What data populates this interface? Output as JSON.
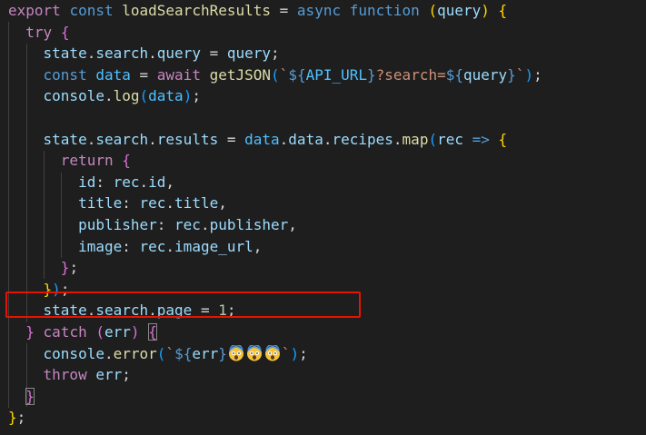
{
  "editor": {
    "background": "#1e1e1e",
    "highlight_color": "#e51400",
    "emoji_name": "face-screaming-in-fear",
    "lines": [
      [
        {
          "t": "export",
          "c": "kw2"
        },
        {
          "t": " "
        },
        {
          "t": "const",
          "c": "kw"
        },
        {
          "t": " "
        },
        {
          "t": "loadSearchResults",
          "c": "fn"
        },
        {
          "t": " = "
        },
        {
          "t": "async",
          "c": "kw"
        },
        {
          "t": " "
        },
        {
          "t": "function",
          "c": "kw"
        },
        {
          "t": " "
        },
        {
          "t": "(",
          "c": "p1"
        },
        {
          "t": "query",
          "c": "var"
        },
        {
          "t": ")",
          "c": "p1"
        },
        {
          "t": " "
        },
        {
          "t": "{",
          "c": "p1"
        }
      ],
      [
        {
          "t": "  "
        },
        {
          "t": "try",
          "c": "kw2"
        },
        {
          "t": " "
        },
        {
          "t": "{",
          "c": "p2"
        }
      ],
      [
        {
          "t": "    "
        },
        {
          "t": "state",
          "c": "var"
        },
        {
          "t": "."
        },
        {
          "t": "search",
          "c": "var"
        },
        {
          "t": "."
        },
        {
          "t": "query",
          "c": "var"
        },
        {
          "t": " = "
        },
        {
          "t": "query",
          "c": "var"
        },
        {
          "t": ";"
        }
      ],
      [
        {
          "t": "    "
        },
        {
          "t": "const",
          "c": "kw"
        },
        {
          "t": " "
        },
        {
          "t": "data",
          "c": "const"
        },
        {
          "t": " = "
        },
        {
          "t": "await",
          "c": "kw2"
        },
        {
          "t": " "
        },
        {
          "t": "getJSON",
          "c": "fn"
        },
        {
          "t": "(",
          "c": "p3"
        },
        {
          "t": "`",
          "c": "str"
        },
        {
          "t": "${",
          "c": "tmpl"
        },
        {
          "t": "API_URL",
          "c": "const"
        },
        {
          "t": "}",
          "c": "tmpl"
        },
        {
          "t": "?search=",
          "c": "str"
        },
        {
          "t": "${",
          "c": "tmpl"
        },
        {
          "t": "query",
          "c": "var"
        },
        {
          "t": "}",
          "c": "tmpl"
        },
        {
          "t": "`",
          "c": "str"
        },
        {
          "t": ")",
          "c": "p3"
        },
        {
          "t": ";"
        }
      ],
      [
        {
          "t": "    "
        },
        {
          "t": "console",
          "c": "var"
        },
        {
          "t": "."
        },
        {
          "t": "log",
          "c": "fn"
        },
        {
          "t": "(",
          "c": "p3"
        },
        {
          "t": "data",
          "c": "const"
        },
        {
          "t": ")",
          "c": "p3"
        },
        {
          "t": ";"
        }
      ],
      [],
      [
        {
          "t": "    "
        },
        {
          "t": "state",
          "c": "var"
        },
        {
          "t": "."
        },
        {
          "t": "search",
          "c": "var"
        },
        {
          "t": "."
        },
        {
          "t": "results",
          "c": "var"
        },
        {
          "t": " = "
        },
        {
          "t": "data",
          "c": "const"
        },
        {
          "t": "."
        },
        {
          "t": "data",
          "c": "var"
        },
        {
          "t": "."
        },
        {
          "t": "recipes",
          "c": "var"
        },
        {
          "t": "."
        },
        {
          "t": "map",
          "c": "fn"
        },
        {
          "t": "(",
          "c": "p3"
        },
        {
          "t": "rec",
          "c": "var"
        },
        {
          "t": " "
        },
        {
          "t": "=>",
          "c": "kw"
        },
        {
          "t": " "
        },
        {
          "t": "{",
          "c": "p1"
        }
      ],
      [
        {
          "t": "      "
        },
        {
          "t": "return",
          "c": "kw2"
        },
        {
          "t": " "
        },
        {
          "t": "{",
          "c": "p2"
        }
      ],
      [
        {
          "t": "        "
        },
        {
          "t": "id",
          "c": "var"
        },
        {
          "t": ": "
        },
        {
          "t": "rec",
          "c": "var"
        },
        {
          "t": "."
        },
        {
          "t": "id",
          "c": "var"
        },
        {
          "t": ","
        }
      ],
      [
        {
          "t": "        "
        },
        {
          "t": "title",
          "c": "var"
        },
        {
          "t": ": "
        },
        {
          "t": "rec",
          "c": "var"
        },
        {
          "t": "."
        },
        {
          "t": "title",
          "c": "var"
        },
        {
          "t": ","
        }
      ],
      [
        {
          "t": "        "
        },
        {
          "t": "publisher",
          "c": "var"
        },
        {
          "t": ": "
        },
        {
          "t": "rec",
          "c": "var"
        },
        {
          "t": "."
        },
        {
          "t": "publisher",
          "c": "var"
        },
        {
          "t": ","
        }
      ],
      [
        {
          "t": "        "
        },
        {
          "t": "image",
          "c": "var"
        },
        {
          "t": ": "
        },
        {
          "t": "rec",
          "c": "var"
        },
        {
          "t": "."
        },
        {
          "t": "image_url",
          "c": "var"
        },
        {
          "t": ","
        }
      ],
      [
        {
          "t": "      "
        },
        {
          "t": "}",
          "c": "p2"
        },
        {
          "t": ";"
        }
      ],
      [
        {
          "t": "    "
        },
        {
          "t": "}",
          "c": "p1"
        },
        {
          "t": ")",
          "c": "p3"
        },
        {
          "t": ";"
        }
      ],
      [
        {
          "t": "    "
        },
        {
          "t": "state",
          "c": "var"
        },
        {
          "t": "."
        },
        {
          "t": "search",
          "c": "var"
        },
        {
          "t": "."
        },
        {
          "t": "page",
          "c": "var"
        },
        {
          "t": " = "
        },
        {
          "t": "1",
          "c": "num"
        },
        {
          "t": ";"
        }
      ],
      [
        {
          "t": "  "
        },
        {
          "t": "}",
          "c": "p2"
        },
        {
          "t": " "
        },
        {
          "t": "catch",
          "c": "kw2"
        },
        {
          "t": " "
        },
        {
          "t": "(",
          "c": "p2"
        },
        {
          "t": "err",
          "c": "var"
        },
        {
          "t": ")",
          "c": "p2"
        },
        {
          "t": " "
        },
        {
          "t": "{",
          "c": "p2",
          "m": 1
        }
      ],
      [
        {
          "t": "    "
        },
        {
          "t": "console",
          "c": "var"
        },
        {
          "t": "."
        },
        {
          "t": "error",
          "c": "fn"
        },
        {
          "t": "(",
          "c": "p3"
        },
        {
          "t": "`",
          "c": "str"
        },
        {
          "t": "${",
          "c": "tmpl"
        },
        {
          "t": "err",
          "c": "var"
        },
        {
          "t": "}",
          "c": "tmpl"
        },
        {
          "e": 1
        },
        {
          "e": 1
        },
        {
          "e": 1
        },
        {
          "t": "`",
          "c": "str"
        },
        {
          "t": ")",
          "c": "p3"
        },
        {
          "t": ";"
        }
      ],
      [
        {
          "t": "    "
        },
        {
          "t": "throw",
          "c": "kw2"
        },
        {
          "t": " "
        },
        {
          "t": "err",
          "c": "var"
        },
        {
          "t": ";"
        }
      ],
      [
        {
          "t": "  "
        },
        {
          "t": "}",
          "c": "p2",
          "m": 1
        }
      ],
      [
        {
          "t": "}",
          "c": "p1"
        },
        {
          "t": ";"
        }
      ]
    ]
  }
}
